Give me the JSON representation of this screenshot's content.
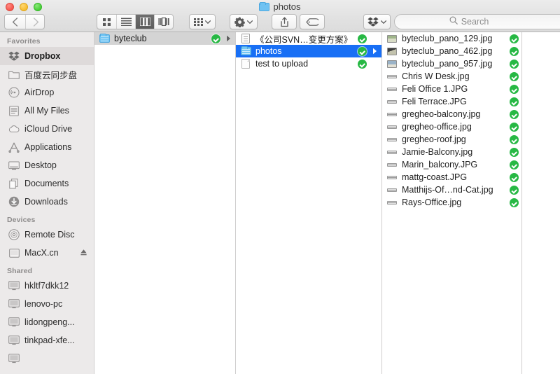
{
  "window": {
    "title": "photos",
    "traffic_lights": [
      "close",
      "minimize",
      "zoom"
    ],
    "colors": {
      "accent_selection": "#186ff5",
      "sync_badge": "#27b844",
      "sidebar_bg": "#eceaea"
    }
  },
  "toolbar": {
    "back_label": "Back",
    "forward_label": "Forward",
    "view_icon_label": "Icon View",
    "view_list_label": "List View",
    "view_column_label": "Column View",
    "view_coverflow_label": "Cover Flow View",
    "active_view": "Column View",
    "arrange_label": "Arrange",
    "action_label": "Action",
    "share_label": "Share",
    "tag_label": "Tags",
    "dropbox_label": "Dropbox"
  },
  "search": {
    "placeholder": "Search",
    "value": ""
  },
  "sidebar": {
    "sections": [
      {
        "header": "Favorites",
        "items": [
          {
            "label": "Dropbox",
            "icon": "dropbox-icon",
            "selected": true
          },
          {
            "label": "百度云同步盘",
            "icon": "folder-icon",
            "selected": false
          },
          {
            "label": "AirDrop",
            "icon": "airdrop-icon",
            "selected": false
          },
          {
            "label": "All My Files",
            "icon": "all-my-files-icon",
            "selected": false
          },
          {
            "label": "iCloud Drive",
            "icon": "icloud-icon",
            "selected": false
          },
          {
            "label": "Applications",
            "icon": "applications-icon",
            "selected": false
          },
          {
            "label": "Desktop",
            "icon": "desktop-icon",
            "selected": false
          },
          {
            "label": "Documents",
            "icon": "documents-icon",
            "selected": false
          },
          {
            "label": "Downloads",
            "icon": "downloads-icon",
            "selected": false
          }
        ]
      },
      {
        "header": "Devices",
        "items": [
          {
            "label": "Remote Disc",
            "icon": "remote-disc-icon",
            "selected": false
          },
          {
            "label": "MacX.cn",
            "icon": "hard-drive-icon",
            "selected": false,
            "eject": true
          }
        ]
      },
      {
        "header": "Shared",
        "items": [
          {
            "label": "hkltf7dkk12",
            "icon": "display-icon",
            "selected": false
          },
          {
            "label": "lenovo-pc",
            "icon": "display-icon",
            "selected": false
          },
          {
            "label": "lidongpeng...",
            "icon": "display-icon",
            "selected": false
          },
          {
            "label": "tinkpad-xfe...",
            "icon": "display-icon",
            "selected": false
          },
          {
            "label": "",
            "icon": "display-icon",
            "selected": false
          }
        ]
      }
    ]
  },
  "columns": [
    {
      "name": "column-1",
      "rows": [
        {
          "label": "byteclub",
          "icon": "folder-icon",
          "selected": "inactive",
          "badge": "sync-ok",
          "has_arrow": true
        }
      ]
    },
    {
      "name": "column-2",
      "rows": [
        {
          "label": "《公司SVN…变更方案》",
          "icon": "text-document-icon",
          "selected": "none",
          "badge": "sync-ok",
          "has_arrow": false
        },
        {
          "label": "photos",
          "icon": "folder-icon",
          "selected": "active",
          "badge": "sync-ok",
          "has_arrow": true
        },
        {
          "label": "test to upload",
          "icon": "document-icon",
          "selected": "none",
          "badge": "sync-ok",
          "has_arrow": false
        }
      ]
    },
    {
      "name": "column-3",
      "rows": [
        {
          "label": "byteclub_pano_129.jpg",
          "icon": "image-thumb-a-icon",
          "selected": "none",
          "badge": "sync-ok",
          "has_arrow": false
        },
        {
          "label": "byteclub_pano_462.jpg",
          "icon": "image-thumb-b-icon",
          "selected": "none",
          "badge": "sync-ok",
          "has_arrow": false
        },
        {
          "label": "byteclub_pano_957.jpg",
          "icon": "image-thumb-c-icon",
          "selected": "none",
          "badge": "sync-ok",
          "has_arrow": false
        },
        {
          "label": "Chris W Desk.jpg",
          "icon": "image-flat-icon",
          "selected": "none",
          "badge": "sync-ok",
          "has_arrow": false
        },
        {
          "label": "Feli Office 1.JPG",
          "icon": "image-flat-icon",
          "selected": "none",
          "badge": "sync-ok",
          "has_arrow": false
        },
        {
          "label": "Feli Terrace.JPG",
          "icon": "image-flat-icon",
          "selected": "none",
          "badge": "sync-ok",
          "has_arrow": false
        },
        {
          "label": "gregheo-balcony.jpg",
          "icon": "image-flat-icon",
          "selected": "none",
          "badge": "sync-ok",
          "has_arrow": false
        },
        {
          "label": "gregheo-office.jpg",
          "icon": "image-flat-icon",
          "selected": "none",
          "badge": "sync-ok",
          "has_arrow": false
        },
        {
          "label": "gregheo-roof.jpg",
          "icon": "image-flat-icon",
          "selected": "none",
          "badge": "sync-ok",
          "has_arrow": false
        },
        {
          "label": "Jamie-Balcony.jpg",
          "icon": "image-flat-icon",
          "selected": "none",
          "badge": "sync-ok",
          "has_arrow": false
        },
        {
          "label": "Marin_balcony.JPG",
          "icon": "image-flat-icon",
          "selected": "none",
          "badge": "sync-ok",
          "has_arrow": false
        },
        {
          "label": "mattg-coast.JPG",
          "icon": "image-flat-icon",
          "selected": "none",
          "badge": "sync-ok",
          "has_arrow": false
        },
        {
          "label": "Matthijs-Of…nd-Cat.jpg",
          "icon": "image-flat-icon",
          "selected": "none",
          "badge": "sync-ok",
          "has_arrow": false
        },
        {
          "label": "Rays-Office.jpg",
          "icon": "image-flat-icon",
          "selected": "none",
          "badge": "sync-ok",
          "has_arrow": false
        }
      ]
    },
    {
      "name": "column-4",
      "rows": []
    }
  ]
}
